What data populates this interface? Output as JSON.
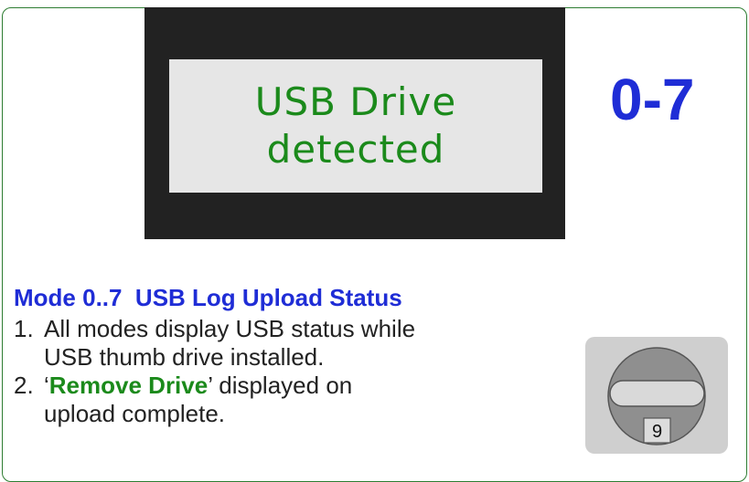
{
  "lcd": {
    "line1": "USB Drive",
    "line2": "detected"
  },
  "mode_number": "0-7",
  "heading": "Mode 0..7  USB Log Upload Status",
  "steps": [
    {
      "num": "1.",
      "text": "All modes display USB status while USB thumb drive installed."
    },
    {
      "num": "2.",
      "before": "‘",
      "highlight": "Remove Drive",
      "after": "’ displayed on upload complete."
    }
  ],
  "knob": {
    "position_label": "9",
    "icon": "rotary-switch-icon"
  },
  "colors": {
    "border": "#2e7d32",
    "lcd_text": "#1b8a1b",
    "accent_blue": "#1f2dd6",
    "highlight_green": "#1b8a1b",
    "bezel": "#222222",
    "lcd_bg": "#e6e6e6"
  }
}
